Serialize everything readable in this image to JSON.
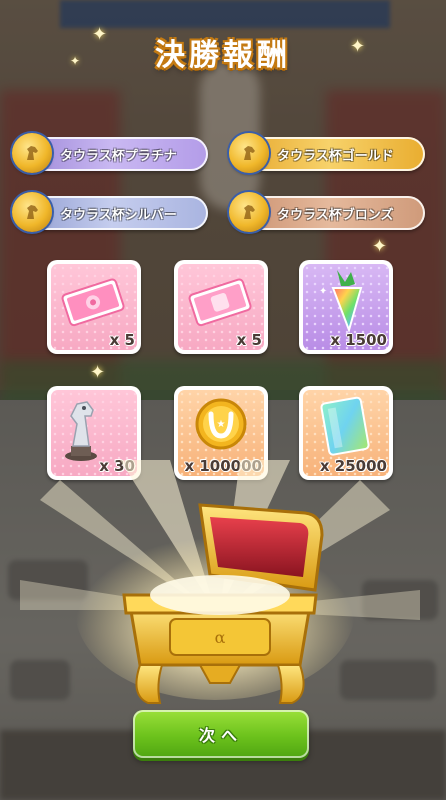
{
  "title": "決勝報酬",
  "cups": [
    {
      "label": "タウラス杯プラチナ",
      "tier": "platinum"
    },
    {
      "label": "タウラス杯ゴールド",
      "tier": "gold"
    },
    {
      "label": "タウラス杯シルバー",
      "tier": "silver"
    },
    {
      "label": "タウラス杯ブロンズ",
      "tier": "bronze"
    }
  ],
  "rewards": [
    {
      "item": "pink-ticket",
      "quantity": "x 5"
    },
    {
      "item": "pink-ticket-2",
      "quantity": "x 5"
    },
    {
      "item": "rainbow-carrot",
      "quantity": "x 1500"
    },
    {
      "item": "silver-horse-trophy",
      "quantity": "x 30"
    },
    {
      "item": "gold-horseshoe-coin",
      "quantity": "x 100000"
    },
    {
      "item": "rainbow-card",
      "quantity": "x 25000"
    }
  ],
  "next_button": {
    "label": "次へ"
  },
  "colors": {
    "accent_gold": "#ffc23a",
    "button_green": "#6cc21c"
  }
}
